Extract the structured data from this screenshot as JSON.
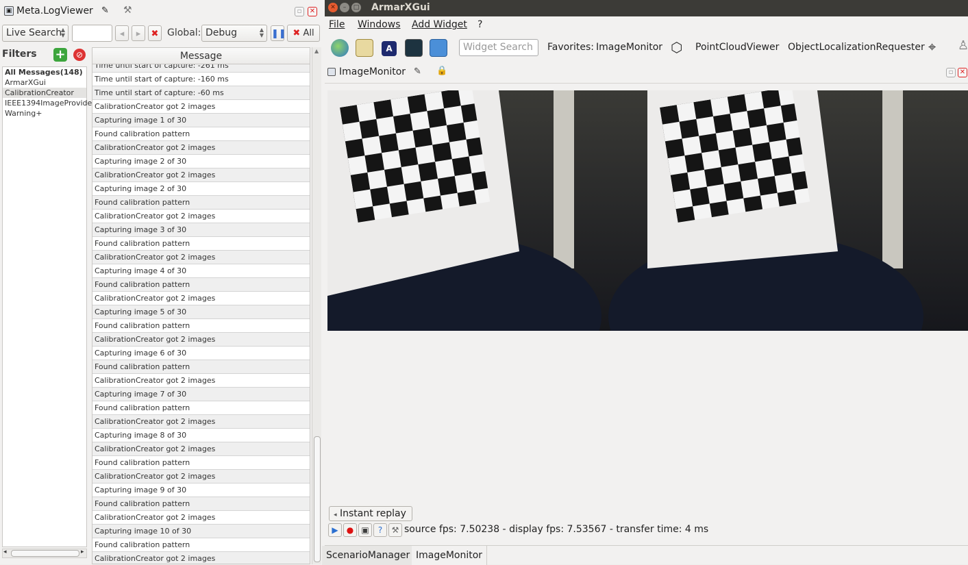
{
  "logviewer": {
    "title": "Meta.LogViewer",
    "live_search": "Live Search",
    "global_label": "Global:",
    "level": "Debug",
    "all_button": "All",
    "filters_label": "Filters",
    "filters": [
      "All Messages(148)",
      "ArmarXGui",
      "CalibrationCreator",
      "IEEE1394ImageProvider",
      "Warning+"
    ],
    "column_header": "Message",
    "messages": [
      "Time until start of capture: -261 ms",
      "Time until start of capture: -160 ms",
      "Time until start of capture: -60 ms",
      "CalibrationCreator got 2 images",
      "Capturing image 1 of 30",
      "Found calibration pattern",
      "CalibrationCreator got 2 images",
      "Capturing image 2 of 30",
      "CalibrationCreator got 2 images",
      "Capturing image 2 of 30",
      "Found calibration pattern",
      "CalibrationCreator got 2 images",
      "Capturing image 3 of 30",
      "Found calibration pattern",
      "CalibrationCreator got 2 images",
      "Capturing image 4 of 30",
      "Found calibration pattern",
      "CalibrationCreator got 2 images",
      "Capturing image 5 of 30",
      "Found calibration pattern",
      "CalibrationCreator got 2 images",
      "Capturing image 6 of 30",
      "Found calibration pattern",
      "CalibrationCreator got 2 images",
      "Capturing image 7 of 30",
      "Found calibration pattern",
      "CalibrationCreator got 2 images",
      "Capturing image 8 of 30",
      "CalibrationCreator got 2 images",
      "Found calibration pattern",
      "CalibrationCreator got 2 images",
      "Capturing image 9 of 30",
      "Found calibration pattern",
      "CalibrationCreator got 2 images",
      "Capturing image 10 of 30",
      "Found calibration pattern",
      "CalibrationCreator got 2 images"
    ]
  },
  "app": {
    "title": "ArmarXGui",
    "menus": [
      "File",
      "Windows",
      "Add Widget",
      "?"
    ],
    "search_placeholder": "Widget Search",
    "favorites_label": "Favorites:",
    "favorites": [
      "ImageMonitor",
      "PointCloudViewer",
      "ObjectLocalizationRequester"
    ],
    "widget_title": "ImageMonitor",
    "replay_label": "Instant replay",
    "status": "source fps: 7.50238 - display fps: 7.53567 - transfer time: 4 ms",
    "tabs": [
      "ScenarioManager",
      "ImageMonitor"
    ]
  },
  "colors": {
    "accent_red": "#d22222",
    "title_bar": "#3c3b37"
  }
}
